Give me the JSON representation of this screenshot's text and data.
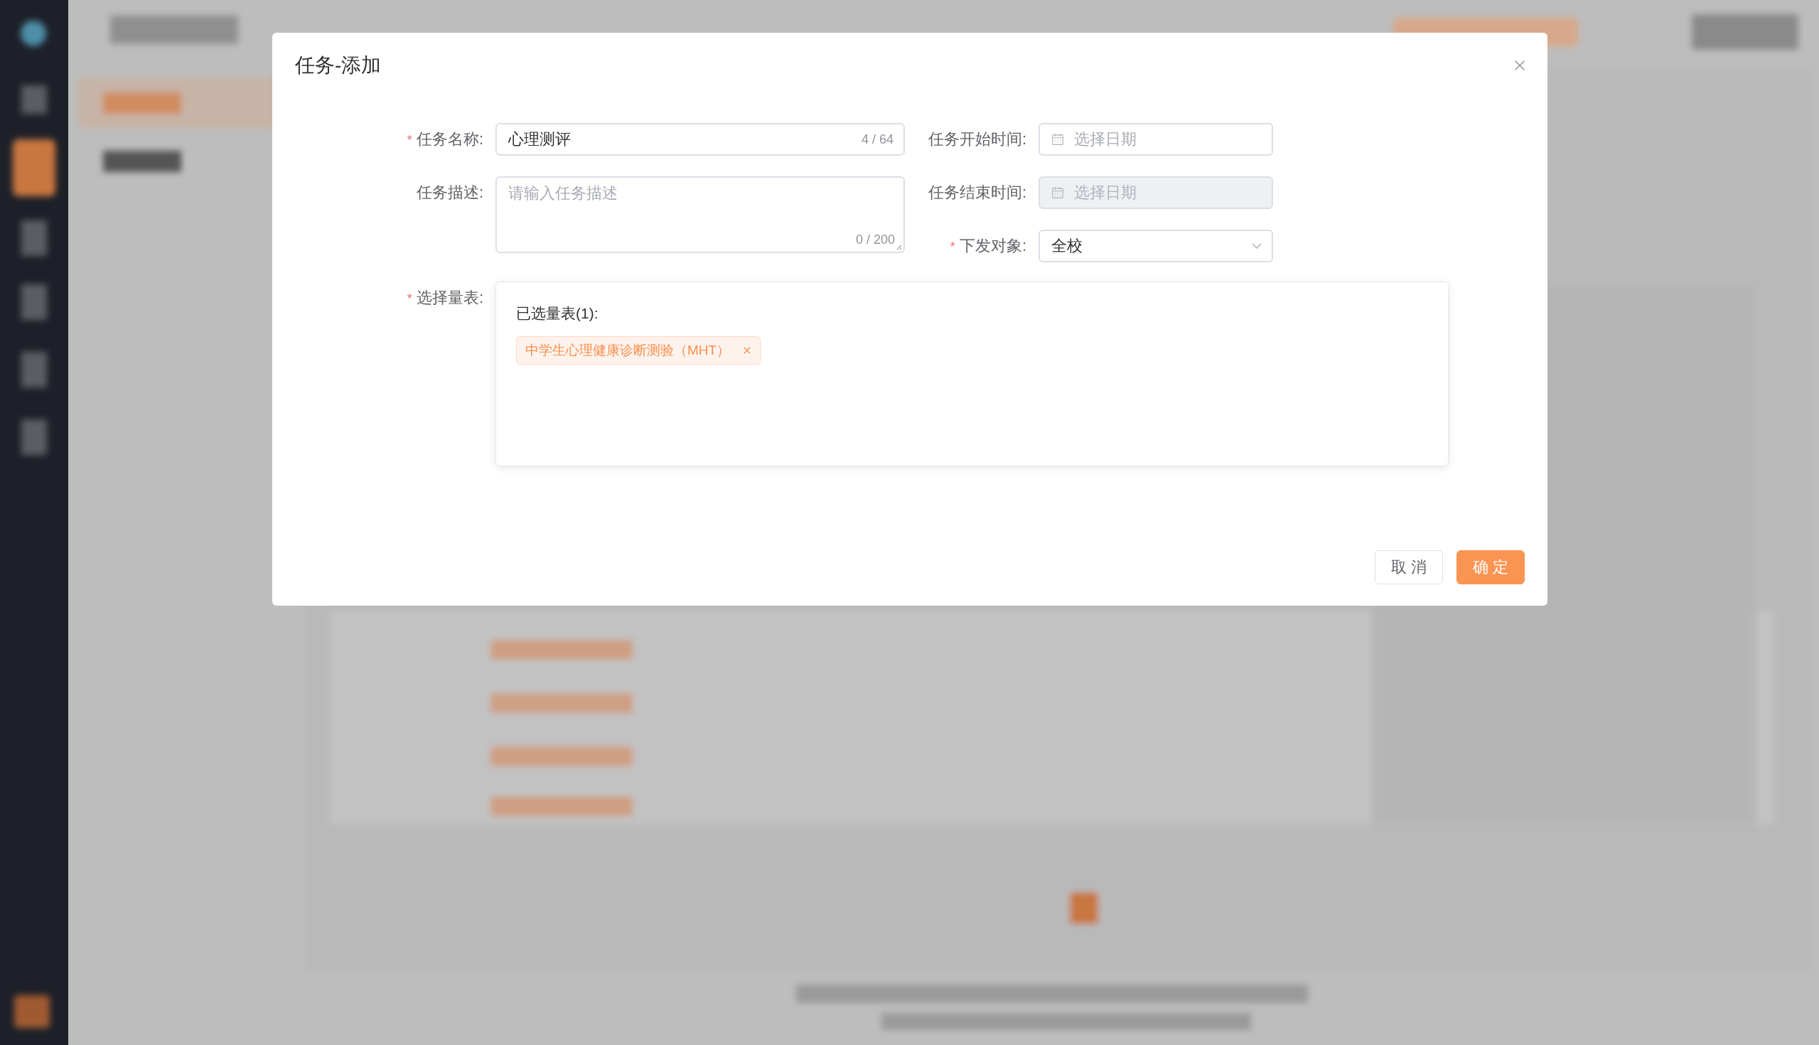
{
  "dialog": {
    "title": "任务-添加"
  },
  "task_name": {
    "mark": "*",
    "label": "任务名称:",
    "value": "心理测评",
    "counter": "4 / 64"
  },
  "description": {
    "label": "任务描述:",
    "placeholder": "请输入任务描述",
    "counter": "0 / 200"
  },
  "start_time": {
    "label": "任务开始时间:",
    "placeholder": "选择日期",
    "disabled": false
  },
  "end_time": {
    "label": "任务结束时间:",
    "placeholder": "选择日期",
    "disabled": true
  },
  "target": {
    "mark": "*",
    "label": "下发对象:",
    "value": "全校"
  },
  "scales": {
    "mark": "*",
    "label": "选择量表:",
    "heading": "已选量表(1):",
    "tags": [
      {
        "label": "中学生心理健康诊断测验（MHT）"
      }
    ]
  },
  "buttons": [
    {
      "label": "取 消",
      "kind": "default"
    },
    {
      "label": "确 定",
      "kind": "primary"
    }
  ]
}
